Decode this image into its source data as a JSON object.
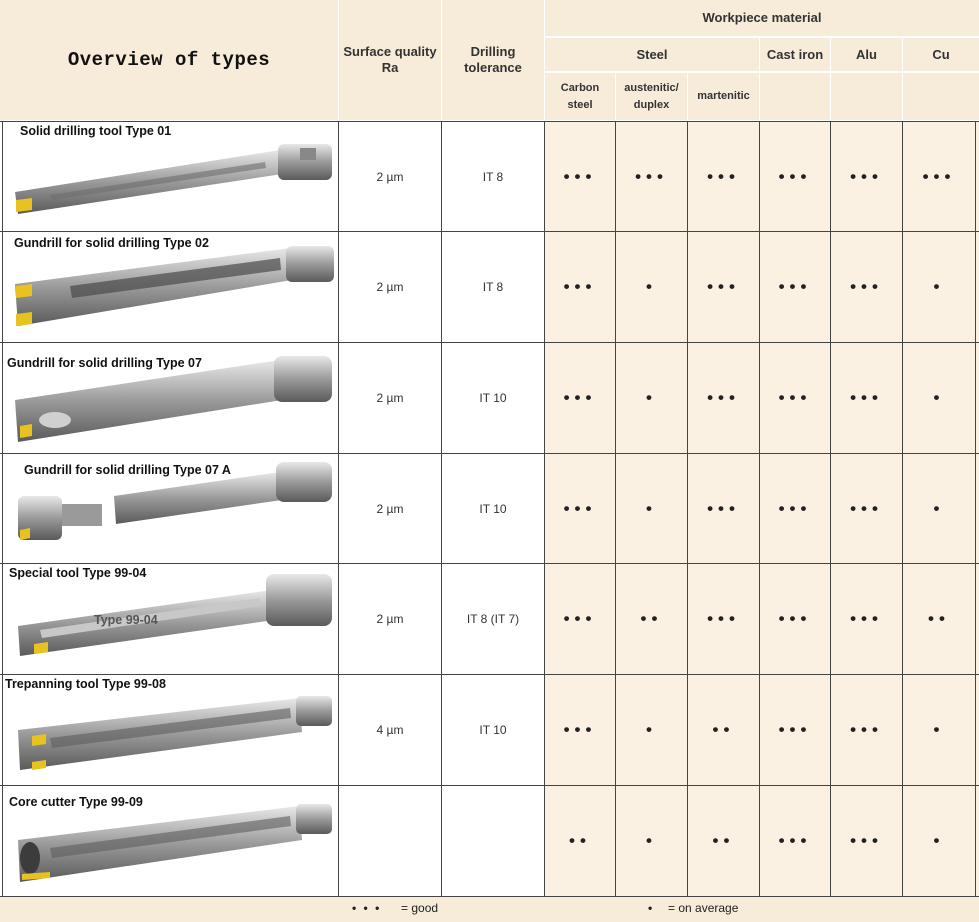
{
  "header": {
    "title": "Overview of types",
    "surface_quality": "Surface quality Ra",
    "drilling_tolerance": "Drilling tolerance",
    "workpiece_material": "Workpiece material",
    "steel": "Steel",
    "cast_iron": "Cast iron",
    "alu": "Alu",
    "cu": "Cu",
    "carbon_steel": "Carbon steel",
    "austenitic_duplex": "austenitic/ duplex",
    "martenitic": "martenitic"
  },
  "rows": [
    {
      "name": "Solid drilling tool Type 01",
      "surface": "2 µm",
      "tolerance": "IT 8",
      "ratings": [
        "•••",
        "•••",
        "•••",
        "•••",
        "•••",
        "•••"
      ]
    },
    {
      "name": "Gundrill for solid drilling Type 02",
      "surface": "2 µm",
      "tolerance": "IT 8",
      "ratings": [
        "•••",
        "•",
        "•••",
        "•••",
        "•••",
        "•"
      ]
    },
    {
      "name": "Gundrill for solid drilling Type 07",
      "surface": "2 µm",
      "tolerance": "IT 10",
      "ratings": [
        "•••",
        "•",
        "•••",
        "•••",
        "•••",
        "•"
      ]
    },
    {
      "name": "Gundrill for solid drilling Type 07 A",
      "surface": "2 µm",
      "tolerance": "IT 10",
      "ratings": [
        "•••",
        "•",
        "•••",
        "•••",
        "•••",
        "•"
      ]
    },
    {
      "name": "Special tool Type 99-04",
      "surface": "2 µm",
      "tolerance": "IT 8 (IT 7)",
      "ratings": [
        "•••",
        "••",
        "•••",
        "•••",
        "•••",
        "••"
      ],
      "overlay": "Type 99-04"
    },
    {
      "name": "Trepanning tool Type 99-08",
      "surface": "4 µm",
      "tolerance": "IT 10",
      "ratings": [
        "•••",
        "•",
        "••",
        "•••",
        "•••",
        "•"
      ]
    },
    {
      "name": "Core cutter Type 99-09",
      "surface": "",
      "tolerance": "",
      "ratings": [
        "••",
        "•",
        "••",
        "•••",
        "•••",
        "•"
      ]
    }
  ],
  "legend": {
    "good_dots": "• • •",
    "good_label": "= good",
    "avg_dots": "•",
    "avg_label": "= on average"
  },
  "colors": {
    "header_bg": "#f6ecd9",
    "tint_bg": "#faf1e2",
    "grid": "#444444",
    "insert": "#e8c21e"
  }
}
